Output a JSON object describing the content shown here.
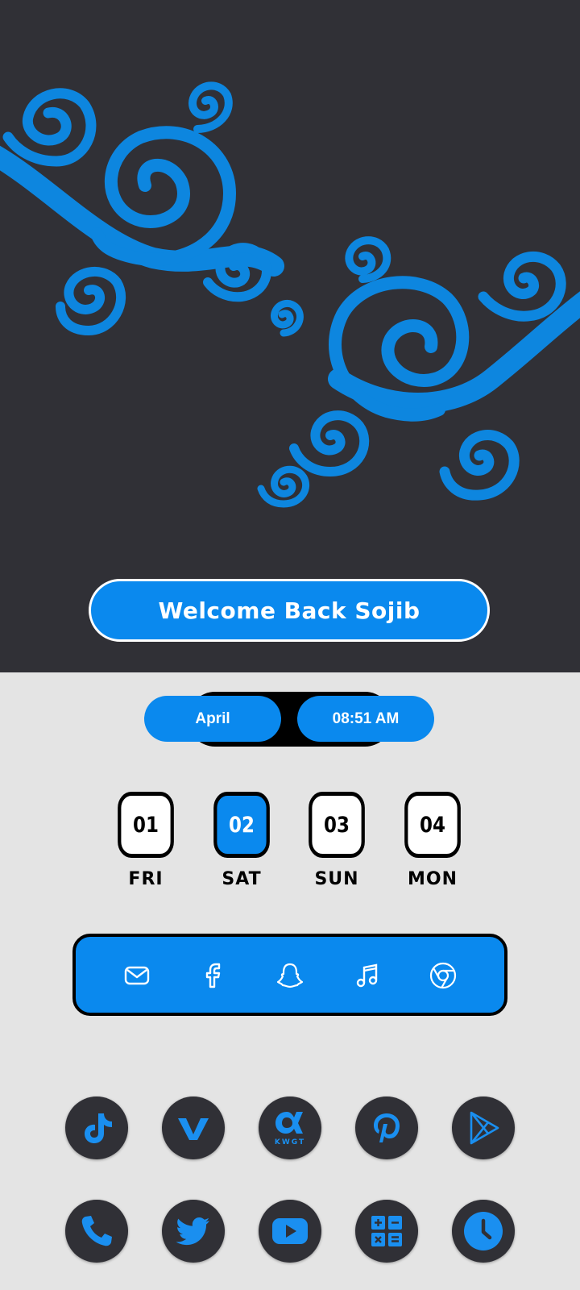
{
  "welcome": {
    "text": "Welcome Back Sojib"
  },
  "status": {
    "month": "April",
    "time": "08:51 AM"
  },
  "days": [
    {
      "num": "01",
      "name": "FRI",
      "active": false
    },
    {
      "num": "02",
      "name": "SAT",
      "active": true
    },
    {
      "num": "03",
      "name": "SUN",
      "active": false
    },
    {
      "num": "04",
      "name": "MON",
      "active": false
    }
  ],
  "dock": {
    "icons": [
      "mail-icon",
      "facebook-icon",
      "snapchat-icon",
      "music-icon",
      "chrome-icon"
    ]
  },
  "apps": {
    "row1": [
      "tiktok-icon",
      "vimeo-icon",
      "kwgt-icon",
      "pinterest-icon",
      "play-store-icon"
    ],
    "row2": [
      "phone-icon",
      "twitter-icon",
      "youtube-icon",
      "calculator-icon",
      "clock-icon"
    ],
    "kwgt_label": "KWGT"
  },
  "colors": {
    "accent": "#0a89ee",
    "dark": "#303036",
    "light": "#e4e4e4"
  }
}
